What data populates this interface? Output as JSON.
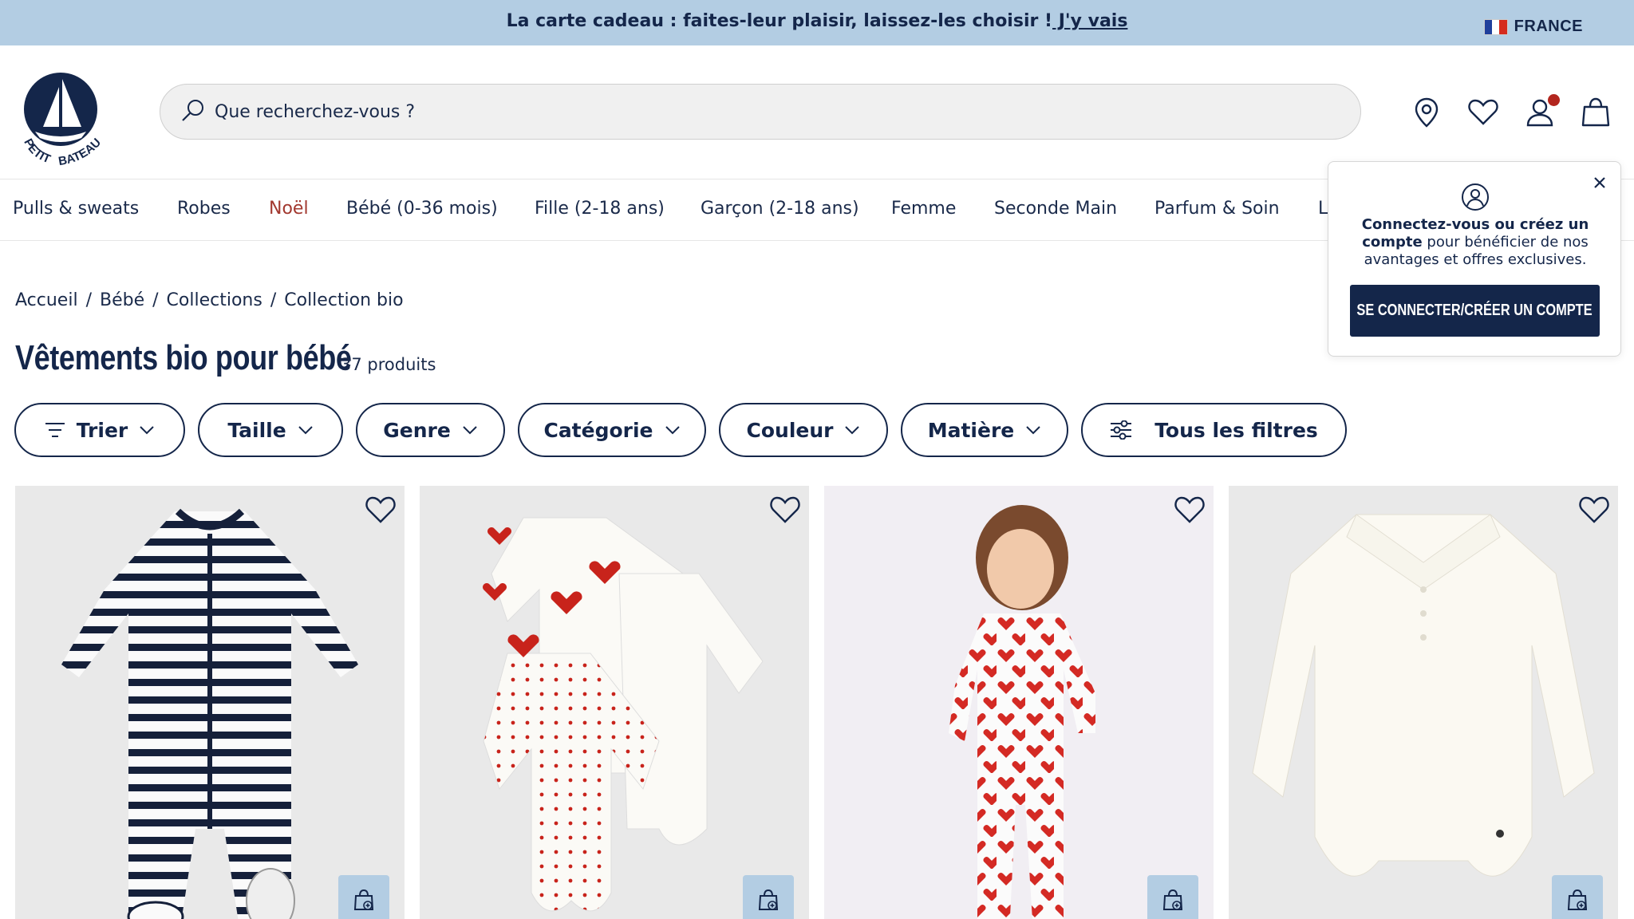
{
  "promo": {
    "text": "La carte cadeau : faites-leur plaisir, laissez-les choisir !",
    "link": " J'y vais",
    "country": "FRANCE"
  },
  "header": {
    "logo_text": "PETIT BATEAU",
    "search_placeholder": "Que recherchez-vous ?",
    "icons": [
      "location-icon",
      "heart-icon",
      "user-icon",
      "bag-icon"
    ]
  },
  "nav": {
    "items": [
      "Pulls & sweats",
      "Robes",
      "Noël",
      "Bébé (0-36 mois)",
      "Fille (2-18 ans)",
      "Garçon (2-18 ans)",
      "Femme",
      "Seconde Main",
      "Parfum & Soin",
      "L"
    ]
  },
  "breadcrumb": {
    "items": [
      "Accueil",
      "Bébé",
      "Collections",
      "Collection bio"
    ],
    "separator": "/"
  },
  "page": {
    "title": "Vêtements bio pour bébé",
    "count": "37 produits"
  },
  "filters": [
    "Trier",
    "Taille",
    "Genre",
    "Catégorie",
    "Couleur",
    "Matière",
    "Tous les filtres"
  ],
  "popup": {
    "bold_text": "Connectez-vous ou créez un compte",
    "text": " pour bénéficier de nos avantages et offres exclusives.",
    "button": "Se connecter/Créer un compte"
  },
  "colors": {
    "navy": "#14264a",
    "promo_bg": "#b3cde3",
    "accent_red": "#a2382f"
  }
}
